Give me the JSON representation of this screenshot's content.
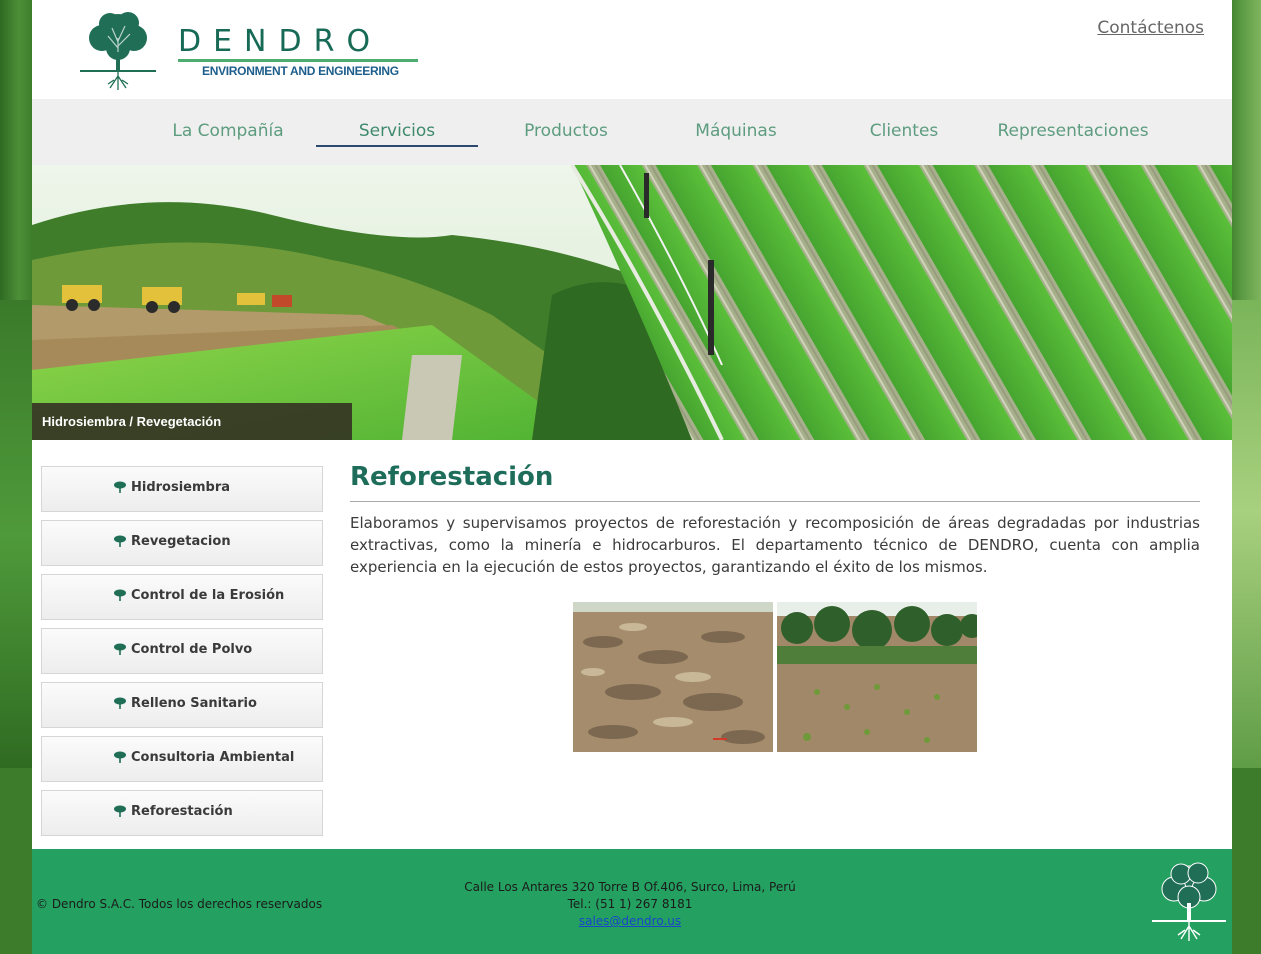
{
  "header": {
    "brand_name": "DENDRO",
    "brand_subtitle": "ENVIRONMENT AND ENGINEERING",
    "contact_link": "Contáctenos"
  },
  "nav": {
    "items": [
      {
        "label": "La Compañía",
        "active": false
      },
      {
        "label": "Servicios",
        "active": true
      },
      {
        "label": "Productos",
        "active": false
      },
      {
        "label": "Máquinas",
        "active": false
      },
      {
        "label": "Clientes",
        "active": false
      },
      {
        "label": "Representaciones",
        "active": false
      }
    ]
  },
  "banner": {
    "caption": "Hidrosiembra / Revegetación"
  },
  "sidebar": {
    "items": [
      {
        "label": "Hidrosiembra",
        "icon": "tree-icon"
      },
      {
        "label": "Revegetacion",
        "icon": "tree-icon"
      },
      {
        "label": "Control de la Erosión",
        "icon": "tree-icon"
      },
      {
        "label": "Control de Polvo",
        "icon": "tree-icon"
      },
      {
        "label": "Relleno Sanitario",
        "icon": "tree-icon"
      },
      {
        "label": "Consultoria Ambiental",
        "icon": "tree-icon"
      },
      {
        "label": "Reforestación",
        "icon": "tree-icon"
      }
    ]
  },
  "main": {
    "title": "Reforestación",
    "body": "Elaboramos y supervisamos proyectos de reforestación y recomposición de áreas degradadas por industrias extractivas, como la minería e hidrocarburos. El departamento técnico de DENDRO, cuenta con amplia experiencia en la ejecución de estos proyectos, garantizando el éxito de los mismos."
  },
  "footer": {
    "copyright": "© Dendro S.A.C. Todos los derechos reservados",
    "address": "Calle Los Antares 320 Torre B Of.406, Surco, Lima, Perú",
    "phone": "Tel.: (51 1) 267 8181",
    "email": "sales@dendro.us"
  },
  "colors": {
    "brand_green": "#176a55",
    "nav_text": "#5d9c7f",
    "footer_green": "#24a060",
    "nav_underline": "#2d4a6e"
  }
}
